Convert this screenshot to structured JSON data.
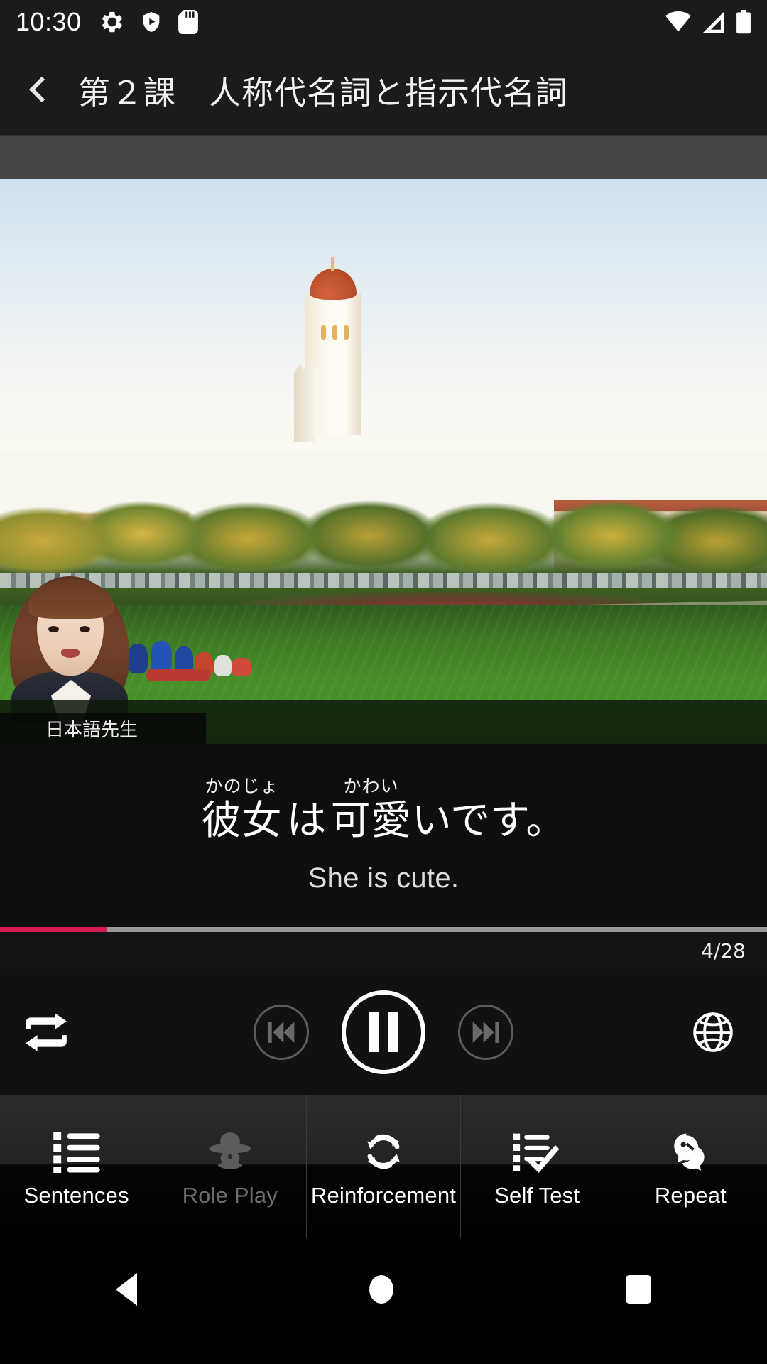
{
  "statusbar": {
    "time": "10:30",
    "left_icons": [
      "gear-icon",
      "shield-play-icon",
      "sd-card-icon"
    ],
    "right_icons": [
      "wifi-icon",
      "cellular-signal-icon",
      "battery-icon"
    ]
  },
  "titlebar": {
    "back_label": "back",
    "title": "第２課　人称代名詞と指示代名詞"
  },
  "video": {
    "thumbnail_caption": "日本語先生",
    "scene": "campus-lawn-with-tower"
  },
  "subtitle": {
    "japanese": [
      {
        "base": "彼女",
        "ruby": "かのじょ"
      },
      {
        "base": "は",
        "ruby": ""
      },
      {
        "base": "可愛",
        "ruby": "かわい"
      },
      {
        "base": "いです。",
        "ruby": ""
      }
    ],
    "english": "She is cute."
  },
  "progress": {
    "counter": "4/28",
    "current": 4,
    "total": 28,
    "percent": 14,
    "fill_color": "#d81b52",
    "track_color": "#9a9a9a"
  },
  "controls": {
    "repeat": "repeat",
    "previous": "previous",
    "play_pause": "pause",
    "next": "next",
    "language": "language"
  },
  "tabs": [
    {
      "label": "Sentences",
      "icon": "list-icon",
      "disabled": false
    },
    {
      "label": "Role Play",
      "icon": "detective-icon",
      "disabled": true
    },
    {
      "label": "Reinforcement",
      "icon": "refresh-loop-icon",
      "disabled": false
    },
    {
      "label": "Self Test",
      "icon": "checklist-icon",
      "disabled": false
    },
    {
      "label": "Repeat",
      "icon": "two-faces-icon",
      "disabled": false
    }
  ],
  "navbar": {
    "back": "back",
    "home": "home",
    "recents": "recents"
  }
}
